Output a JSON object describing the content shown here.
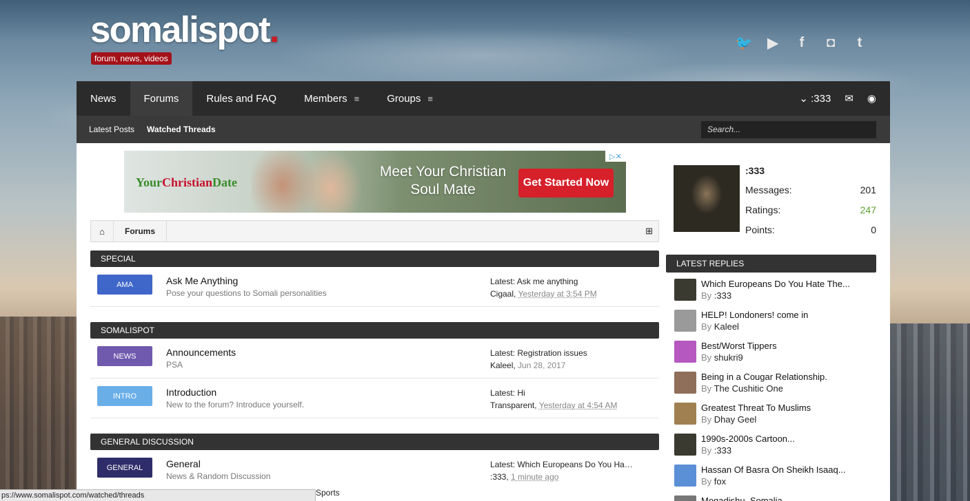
{
  "header": {
    "logo": "somalispot",
    "logo_dot": ".",
    "tagline": "forum, news, videos",
    "social": [
      {
        "icon": "twitter-icon",
        "glyph": "🐦"
      },
      {
        "icon": "youtube-icon",
        "glyph": "▶"
      },
      {
        "icon": "facebook-icon",
        "glyph": "f"
      },
      {
        "icon": "instagram-icon",
        "glyph": "◘"
      },
      {
        "icon": "tumblr-icon",
        "glyph": "t"
      }
    ]
  },
  "nav": {
    "tabs": [
      "News",
      "Forums",
      "Rules and FAQ",
      "Members",
      "Groups"
    ],
    "menu_glyph": "≡",
    "user": "⌄ :333",
    "mail_glyph": "✉",
    "globe_glyph": "◉"
  },
  "subnav": {
    "latest_posts": "Latest Posts",
    "watched_threads": "Watched Threads",
    "search_placeholder": "Search..."
  },
  "ad": {
    "brand_green": "Your",
    "brand_red": "Christian",
    "brand_tail": "Date",
    "headline": "Meet Your Christian Soul Mate",
    "cta": "Get Started Now",
    "close": "▷✕"
  },
  "breadcrumb": {
    "home_glyph": "⌂",
    "current": "Forums",
    "sitemap_glyph": "⊞"
  },
  "categories": [
    {
      "title": "SPECIAL",
      "forums": [
        {
          "badge": "AMA",
          "color": "#3f66c9",
          "title": "Ask Me Anything",
          "desc": "Pose your questions to Somali personalities",
          "latest": "Latest: Ask me anything",
          "by": "Cigaal,",
          "date": "Yesterday at 3:54 PM"
        }
      ]
    },
    {
      "title": "SOMALISPOT",
      "forums": [
        {
          "badge": "NEWS",
          "color": "#6f5aae",
          "title": "Announcements",
          "desc": "PSA",
          "latest": "Latest: Registration issues",
          "by": "Kaleel,",
          "date": "Jun 28, 2017"
        },
        {
          "badge": "INTRO",
          "color": "#6aaee8",
          "title": "Introduction",
          "desc": "New to the forum? Introduce yourself.",
          "latest": "Latest: Hi",
          "by": "Transparent,",
          "date": "Yesterday at 4:54 AM"
        }
      ]
    },
    {
      "title": "GENERAL DISCUSSION",
      "forums": [
        {
          "badge": "GENERAL",
          "color": "#2e2d6a",
          "title": "General",
          "desc": "News & Random Discussion",
          "latest": "Latest: Which Europeans Do You Ha…",
          "by": ":333,",
          "date": "1 minute ago"
        }
      ]
    }
  ],
  "profile": {
    "name": ":333",
    "stats": [
      {
        "label": "Messages:",
        "value": "201"
      },
      {
        "label": "Ratings:",
        "value": "247"
      },
      {
        "label": "Points:",
        "value": "0"
      }
    ]
  },
  "latest_replies": {
    "title": "LATEST REPLIES",
    "items": [
      {
        "title": "Which Europeans Do You Hate The...",
        "by": ":333",
        "av": "#3a3a30"
      },
      {
        "title": "HELP! Londoners! come in",
        "by": "Kaleel",
        "av": "#9a9a9a"
      },
      {
        "title": "Best/Worst Tippers",
        "by": "shukri9",
        "av": "#b558c0"
      },
      {
        "title": "Being in a Cougar Relationship.",
        "by": "The Cushitic One",
        "av": "#8f6e5a"
      },
      {
        "title": "Greatest Threat To Muslims",
        "by": "Dhay Geel",
        "av": "#a08050"
      },
      {
        "title": "1990s-2000s Cartoon...",
        "by": ":333",
        "av": "#3a3a30"
      },
      {
        "title": "Hassan Of Basra On Sheikh Isaaq...",
        "by": "fox",
        "av": "#5b8fd6"
      },
      {
        "title": "Mogadishu, Somalia",
        "by": "",
        "av": "#777"
      }
    ]
  },
  "status_url": "ps://www.somalispot.com/watched/threads",
  "peek": "Sports",
  "by_prefix": "By "
}
